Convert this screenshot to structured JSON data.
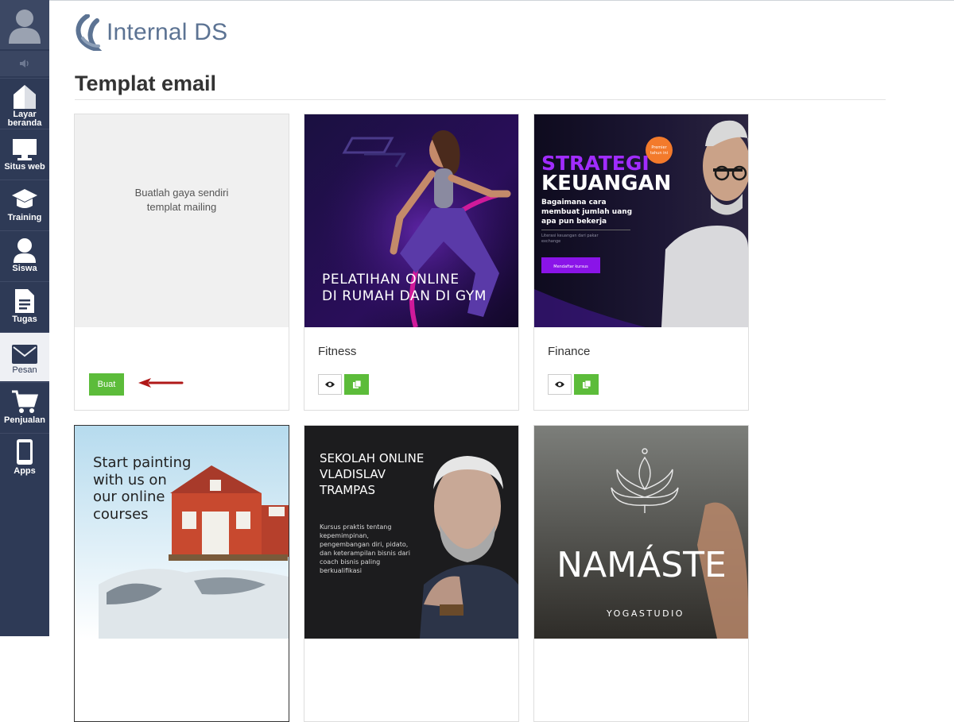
{
  "app": {
    "logo_text": "Internal DS",
    "page_title": "Templat email"
  },
  "sidebar": {
    "items": [
      {
        "label_line1": "Layar",
        "label_line2": "beranda",
        "icon": "home-icon"
      },
      {
        "label_line1": "Situs web",
        "label_line2": "",
        "icon": "monitor-icon"
      },
      {
        "label_line1": "Training",
        "label_line2": "",
        "icon": "graduation-cap-icon"
      },
      {
        "label_line1": "Siswa",
        "label_line2": "",
        "icon": "person-icon"
      },
      {
        "label_line1": "Tugas",
        "label_line2": "",
        "icon": "document-icon"
      },
      {
        "label_line1": "Pesan",
        "label_line2": "",
        "icon": "envelope-icon",
        "active": true
      },
      {
        "label_line1": "Penjualan",
        "label_line2": "",
        "icon": "cart-icon"
      },
      {
        "label_line1": "Apps",
        "label_line2": "",
        "icon": "phone-icon"
      }
    ]
  },
  "templates": {
    "custom": {
      "line1": "Buatlah gaya sendiri",
      "line2": "templat mailing",
      "button_label": "Buat"
    },
    "fitness": {
      "name": "Fitness",
      "thumb_line1": "PELATIHAN ONLINE",
      "thumb_line2": "DI RUMAH DAN DI GYM"
    },
    "finance": {
      "name": "Finance",
      "thumb_title1": "STRATEGI",
      "thumb_title2": "KEUANGAN",
      "thumb_sub1": "Bagaimana cara",
      "thumb_sub2": "membuat jumlah uang",
      "thumb_sub3": "apa pun bekerja",
      "thumb_small1": "Literasi keuangan dari pakar",
      "thumb_small2": "exchange",
      "thumb_button": "Mendaftar kursus",
      "badge1": "Premier",
      "badge2": "tahun ini"
    },
    "painting": {
      "line1": "Start painting",
      "line2": "with us on",
      "line3": "our online",
      "line4": "courses"
    },
    "business": {
      "line1": "SEKOLAH ONLINE",
      "line2": "VLADISLAV",
      "line3": "TRAMPAS",
      "desc1": "Kursus praktis tentang",
      "desc2": "kepemimpinan,",
      "desc3": "pengembangan diri, pidato,",
      "desc4": "dan keterampilan bisnis dari",
      "desc5": "coach bisnis paling",
      "desc6": "berkualifikasi"
    },
    "yoga": {
      "title": "NAMÁSTE",
      "subtitle": "YOGASTUDIO"
    }
  },
  "colors": {
    "sidebar_bg": "#2e3a56",
    "green_button": "#5cbc3a",
    "logo_blue": "#5c7393",
    "arrow_red": "#b01818"
  }
}
